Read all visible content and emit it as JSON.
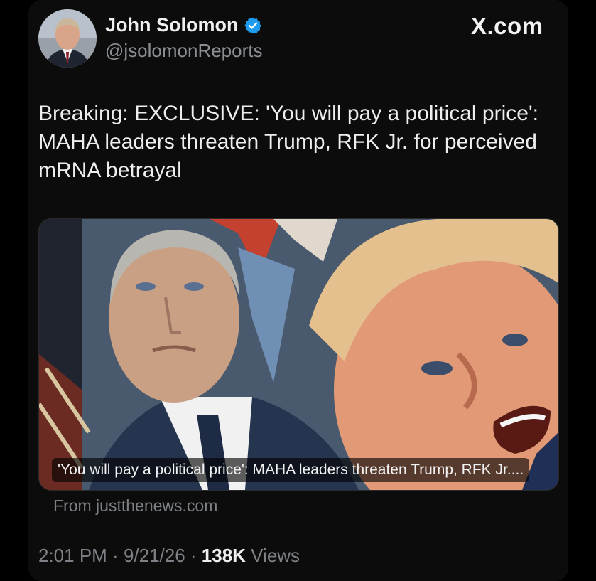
{
  "author": {
    "name": "John Solomon",
    "handle": "@jsolomonReports",
    "verified_color": "#1d9bf0"
  },
  "brand": "X.com",
  "tweet": {
    "text": "Breaking: EXCLUSIVE: 'You will pay a political price': MAHA leaders threaten Trump, RFK Jr. for perceived mRNA betrayal"
  },
  "link_card": {
    "caption": "'You will pay a political price': MAHA leaders threaten Trump, RFK Jr....",
    "source": "From justthenews.com"
  },
  "meta": {
    "time": "2:01 PM",
    "sep1": " · ",
    "date": "9/21/26",
    "sep2": " · ",
    "views_count": "138K",
    "views_label": " Views"
  },
  "colors": {
    "background": "#000000",
    "card": "#0c0c0c",
    "muted_text": "#7d8085"
  }
}
